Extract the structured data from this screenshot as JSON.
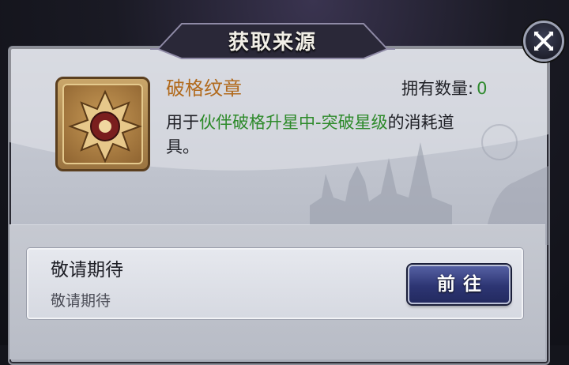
{
  "dialog": {
    "title": "获取来源",
    "close_icon": "close-x-icon"
  },
  "item": {
    "icon": "emblem-icon",
    "name": "破格纹章",
    "owned_label": "拥有数量:",
    "owned_count": "0",
    "desc_part1": "用于",
    "desc_highlight": "伙伴破格升星中-突破星级",
    "desc_part2": "的消耗道具。"
  },
  "sources": [
    {
      "title": "敬请期待",
      "description": "敬请期待",
      "button_label": "前往"
    }
  ],
  "colors": {
    "item_name": "#b16a1d",
    "highlight_green": "#2d8a2a",
    "button_blue": "#2d3573"
  }
}
